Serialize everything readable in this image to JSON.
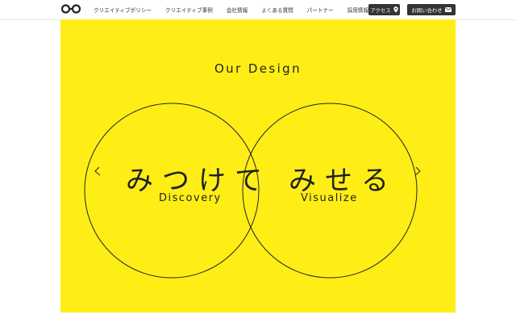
{
  "header": {
    "nav": [
      "クリエイティブポリシー",
      "クリエイティブ事例",
      "会社情報",
      "よくある質問",
      "パートナー",
      "採用情報"
    ],
    "access_label": "アクセス",
    "contact_label": "お問い合わせ"
  },
  "hero": {
    "title": "Our Design",
    "left_kana": "みつけて",
    "left_word": "Discovery",
    "right_kana": "みせる",
    "right_word": "Visualize",
    "background_color": "#ffee16"
  },
  "icons": [
    "logo-icon",
    "map-pin-icon",
    "mail-icon",
    "left-arrow-icon",
    "right-arrow-icon"
  ]
}
